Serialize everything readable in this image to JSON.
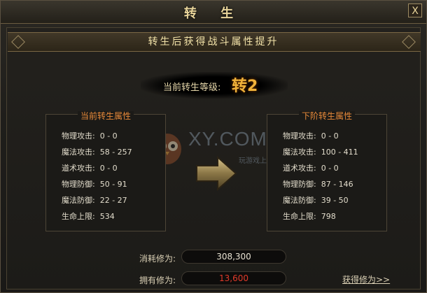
{
  "window": {
    "title": "转 生",
    "close_label": "X"
  },
  "banner": {
    "text": "转生后获得战斗属性提升"
  },
  "level": {
    "label": "当前转生等级:",
    "value": "转2"
  },
  "current_attrs": {
    "title": "当前转生属性",
    "rows": [
      "物理攻击:  0 - 0",
      "魔法攻击:  58 - 257",
      "道术攻击:  0 - 0",
      "物理防御:  50 - 91",
      "魔法防御:  22 - 27",
      "生命上限:  534"
    ]
  },
  "next_attrs": {
    "title": "下阶转生属性",
    "rows": [
      "物理攻击:  0 - 0",
      "魔法攻击:  100 - 411",
      "道术攻击:  0 - 0",
      "物理防御:  87 - 146",
      "魔法防御:  39 - 50",
      "生命上限:  798"
    ]
  },
  "cost": {
    "label": "消耗修为:",
    "value": "308,300",
    "color": "#e8e2d2"
  },
  "owned": {
    "label": "拥有修为:",
    "value": "13,600",
    "color": "#e03a2a"
  },
  "get_link": {
    "label": "获得修为>>"
  },
  "watermark": {
    "text": "XY.COM",
    "sub": "玩游戏上XY"
  }
}
